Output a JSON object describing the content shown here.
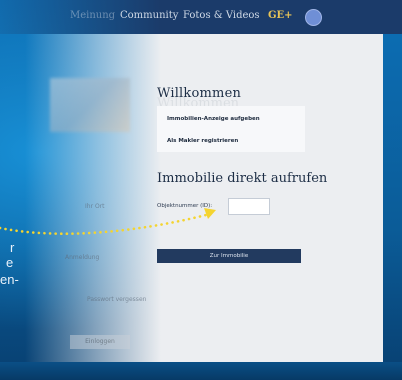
{
  "nav": {
    "items": [
      "Meinung",
      "Community",
      "Fotos & Videos",
      "GE+"
    ]
  },
  "sidebar_faded": {
    "labels": [
      "Ihr Ort",
      "Anmeldung",
      "Passwort vergessen",
      "Einloggen"
    ]
  },
  "main": {
    "welcome": "Willkommen",
    "links": [
      "Immobilien-Anzeige aufgeben",
      "Als Makler registrieren"
    ],
    "direct_title": "Immobilie direkt aufrufen",
    "object_label": "Objektnummer (ID):",
    "object_value": "",
    "submit_label": "Zur Immobilie"
  },
  "callout": {
    "lines": [
      "r",
      "e",
      "en-"
    ]
  },
  "colors": {
    "background_blue": "#0b5c98",
    "nav_bg": "#1b3b6a",
    "accent_gold": "#e8c457",
    "button_navy": "#223a5f",
    "callout_dots": "#f4d430"
  }
}
